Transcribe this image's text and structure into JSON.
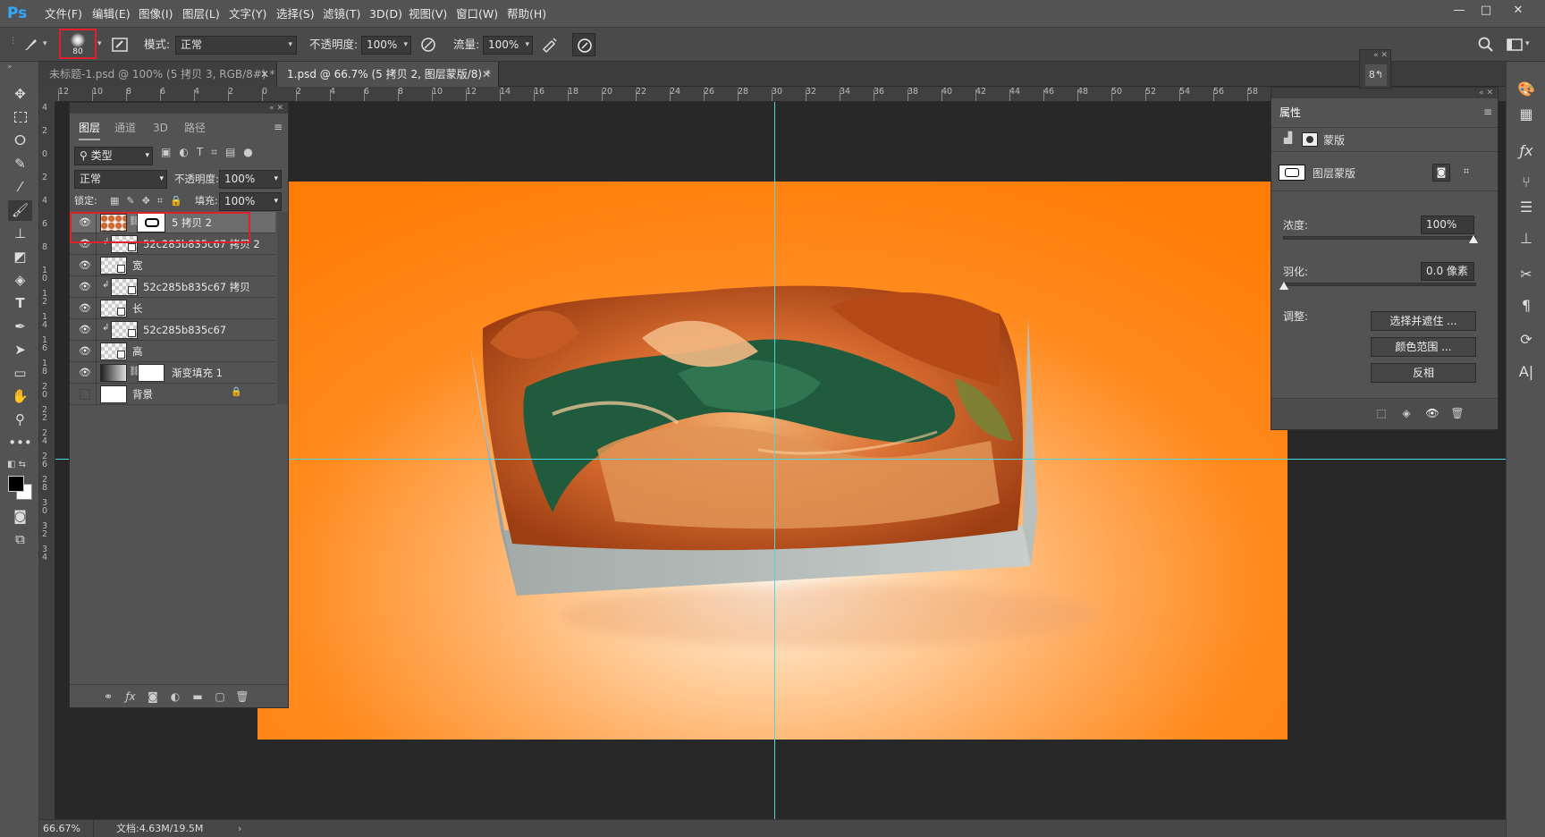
{
  "app": {
    "logo": "Ps",
    "accent": "#31a8ff"
  },
  "menu": [
    "文件(F)",
    "编辑(E)",
    "图像(I)",
    "图层(L)",
    "文字(Y)",
    "选择(S)",
    "滤镜(T)",
    "3D(D)",
    "视图(V)",
    "窗口(W)",
    "帮助(H)"
  ],
  "window_controls": {
    "minimize": "—",
    "restore": "□",
    "close": "✕"
  },
  "options": {
    "brush_size": "80",
    "mode_label": "模式:",
    "mode_value": "正常",
    "opacity_label": "不透明度:",
    "opacity_value": "100%",
    "flow_label": "流量:",
    "flow_value": "100%"
  },
  "tabs": [
    {
      "label": "未标题-1.psd @ 100% (5 拷贝 3, RGB/8#) *",
      "active": false
    },
    {
      "label": "1.psd @ 66.7% (5 拷贝 2, 图层蒙版/8) *",
      "active": true
    }
  ],
  "ruler_h": [
    "12",
    "10",
    "8",
    "6",
    "4",
    "2",
    "0",
    "2",
    "4",
    "6",
    "8",
    "10",
    "12",
    "14",
    "16",
    "18",
    "20",
    "22",
    "24",
    "26",
    "28",
    "30",
    "32",
    "34",
    "36",
    "38",
    "40",
    "42",
    "44",
    "46",
    "48",
    "50",
    "52",
    "54",
    "56",
    "58"
  ],
  "ruler_v": [
    "4",
    "2",
    "0",
    "2",
    "4",
    "6",
    "8",
    "1 0",
    "1 2",
    "1 4",
    "1 6",
    "1 8",
    "2 0",
    "2 2",
    "2 4",
    "2 6",
    "2 8",
    "3 0",
    "3 2",
    "3 4"
  ],
  "layers_panel": {
    "tabs": [
      "图层",
      "通道",
      "3D",
      "路径"
    ],
    "filter_label": "类型",
    "blend_mode": "正常",
    "opacity_label": "不透明度:",
    "opacity_value": "100%",
    "lock_label": "锁定:",
    "fill_label": "填充:",
    "fill_value": "100%",
    "layers": [
      {
        "name": "5 拷贝 2",
        "selected": true,
        "visible": true,
        "mask": true
      },
      {
        "name": "52c285b835c67 拷贝 2",
        "selected": false,
        "visible": true,
        "clipped": true
      },
      {
        "name": "宽",
        "selected": false,
        "visible": true
      },
      {
        "name": "52c285b835c67 拷贝",
        "selected": false,
        "visible": true,
        "clipped": true
      },
      {
        "name": "长",
        "selected": false,
        "visible": true
      },
      {
        "name": "52c285b835c67",
        "selected": false,
        "visible": true,
        "clipped": true
      },
      {
        "name": "高",
        "selected": false,
        "visible": true
      },
      {
        "name": "渐变填充 1",
        "selected": false,
        "visible": true,
        "mask": true,
        "gradient": true
      },
      {
        "name": "背景",
        "selected": false,
        "visible": false,
        "locked": true,
        "white": true
      }
    ]
  },
  "properties_panel": {
    "title": "属性",
    "mask_header": "蒙版",
    "mask_type": "图层蒙版",
    "density_label": "浓度:",
    "density_value": "100%",
    "density_level": 1.0,
    "feather_label": "羽化:",
    "feather_value": "0.0 像素",
    "feather_level": 0.0,
    "refine_label": "调整:",
    "btn_select_mask": "选择并遮住 ...",
    "btn_color_range": "颜色范围 ...",
    "btn_invert": "反相"
  },
  "status": {
    "zoom": "66.67%",
    "doc": "文档:4.63M/19.5M"
  }
}
